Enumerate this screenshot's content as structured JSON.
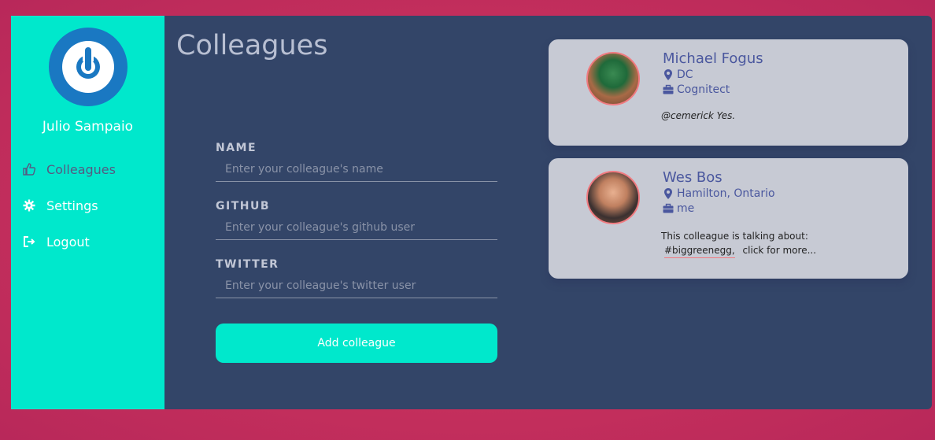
{
  "sidebar": {
    "user_name": "Julio Sampaio",
    "items": [
      {
        "label": "Colleagues",
        "icon": "thumbs-up-icon"
      },
      {
        "label": "Settings",
        "icon": "gear-icon"
      },
      {
        "label": "Logout",
        "icon": "logout-icon"
      }
    ]
  },
  "main": {
    "title": "Colleagues",
    "form": {
      "name_label": "NAME",
      "name_placeholder": "Enter your colleague's name",
      "github_label": "GITHUB",
      "github_placeholder": "Enter your colleague's github user",
      "twitter_label": "TWITTER",
      "twitter_placeholder": "Enter your colleague's twitter user",
      "submit_label": "Add colleague"
    }
  },
  "colleagues": [
    {
      "name": "Michael Fogus",
      "location": "DC",
      "company": "Cognitect",
      "tweet": "@cemerick Yes."
    },
    {
      "name": "Wes Bos",
      "location": "Hamilton, Ontario",
      "company": "me",
      "about_prefix": "This colleague is talking about:",
      "hashtag": "#biggreenegg,",
      "more": "click for more..."
    }
  ],
  "colors": {
    "accent": "#00e8cc",
    "panel": "#334568",
    "card": "#c7cad4",
    "link": "#4a579e",
    "background": "#c42f5c"
  }
}
